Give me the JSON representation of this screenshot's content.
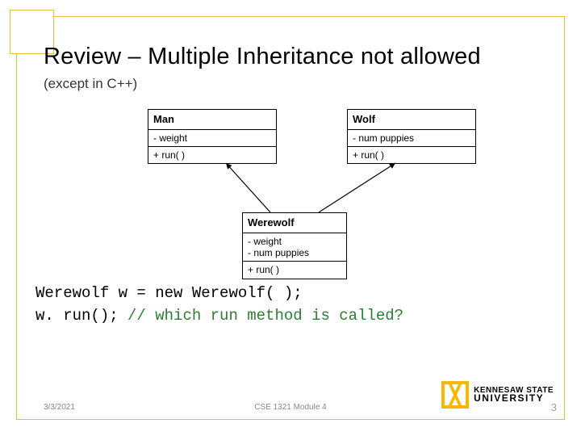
{
  "title": "Review – Multiple Inheritance not allowed",
  "subtitle": "(except in C++)",
  "uml": {
    "man": {
      "name": "Man",
      "attr": "- weight",
      "method": "+ run( )"
    },
    "wolf": {
      "name": "Wolf",
      "attr": "- num puppies",
      "method": "+ run( )"
    },
    "werewolf": {
      "name": "Werewolf",
      "attr1": "- weight",
      "attr2": "- num puppies",
      "method": "+ run( )"
    }
  },
  "code": {
    "line1": "Werewolf w = new Werewolf( );",
    "line2a": "w. run(); ",
    "line2b": "// which run method is called?"
  },
  "logo": {
    "line1": "KENNESAW STATE",
    "line2": "UNIVERSITY"
  },
  "footer": {
    "date": "3/3/2021",
    "mid": "CSE 1321 Module 4",
    "page": "3"
  }
}
